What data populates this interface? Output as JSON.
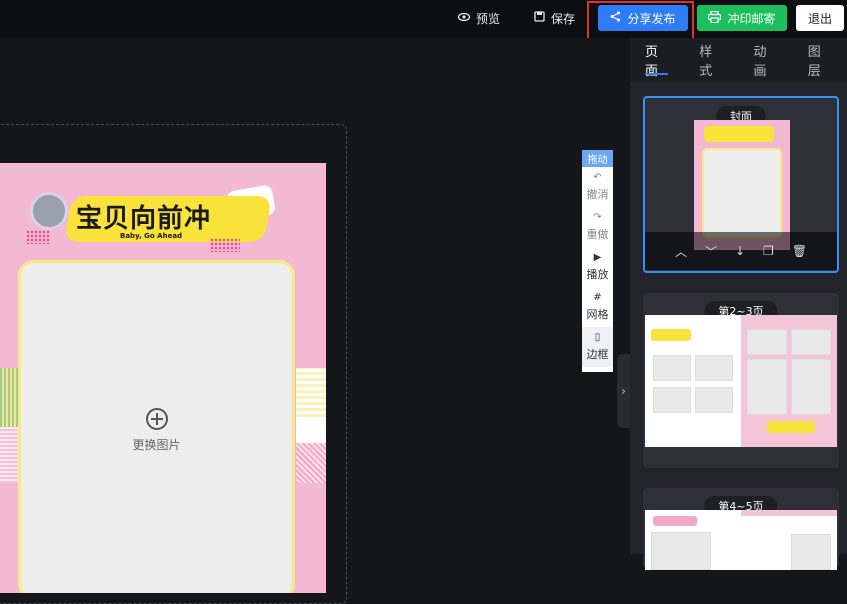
{
  "toolbar": {
    "preview_label": "预览",
    "save_label": "保存",
    "share_label": "分享发布",
    "print_label": "冲印邮寄",
    "exit_label": "退出"
  },
  "canvas": {
    "logo_title": "宝贝向前冲",
    "logo_subtitle": "Baby, Go Ahead",
    "replace_image_label": "更换图片"
  },
  "side_tools": {
    "drag_label": "拖动",
    "items": [
      {
        "label": "撤消",
        "icon": "undo-icon"
      },
      {
        "label": "重做",
        "icon": "redo-icon"
      },
      {
        "label": "播放",
        "icon": "play-icon"
      },
      {
        "label": "网格",
        "icon": "grid-icon"
      },
      {
        "label": "边框",
        "icon": "frame-icon"
      }
    ]
  },
  "panel": {
    "tabs": [
      "页面",
      "样式",
      "动画",
      "图层"
    ],
    "active_tab": "页面",
    "thumbnails": [
      {
        "title": "封面"
      },
      {
        "title": "第2~3页"
      },
      {
        "title": "第4~5页"
      }
    ]
  },
  "colors": {
    "share_button": "#2f7df6",
    "print_button": "#1bbf5c",
    "page_pink": "#f3b9d3",
    "highlight_outline": "#e0302f"
  }
}
